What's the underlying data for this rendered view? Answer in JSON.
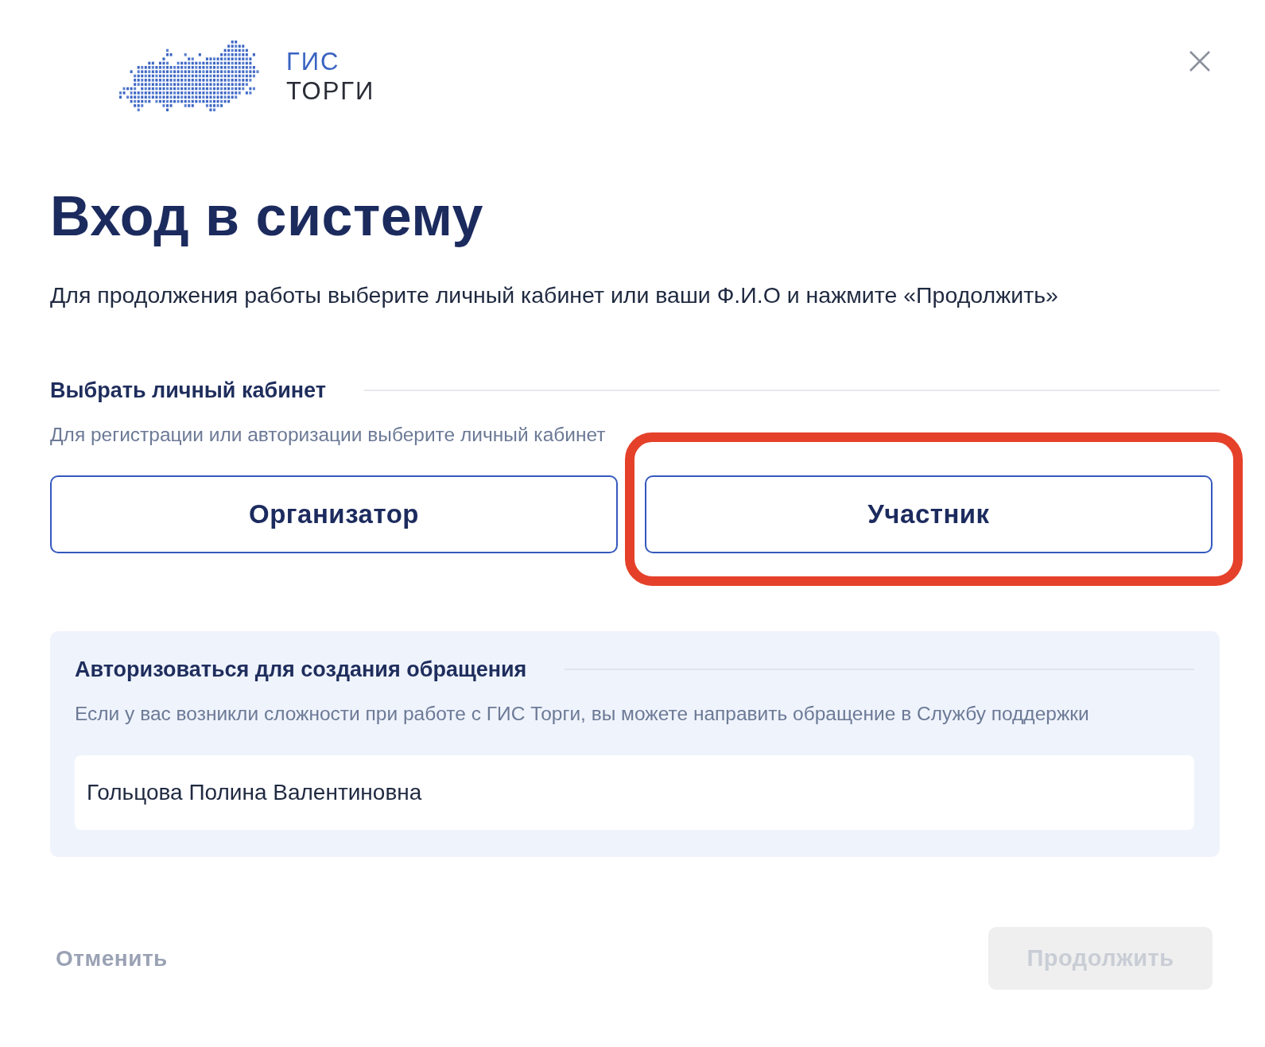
{
  "logo": {
    "line_1": "ГИС",
    "line_2": "ТОРГИ"
  },
  "title": "Вход в систему",
  "subtitle": "Для продолжения работы выберите личный кабинет или ваши Ф.И.О и нажмите «Продолжить»",
  "cabinet_section": {
    "heading": "Выбрать личный кабинет",
    "hint": "Для регистрации или авторизации выберите личный кабинет",
    "options": [
      {
        "label": "Организатор",
        "highlighted": false
      },
      {
        "label": "Участник",
        "highlighted": true
      }
    ]
  },
  "support_section": {
    "heading": "Авторизоваться для создания обращения",
    "hint": "Если у вас возникли сложности при работе с ГИС Торги, вы можете направить обращение в Службу поддержки",
    "name_field": {
      "value": "Гольцова Полина Валентиновна"
    }
  },
  "actions": {
    "cancel": {
      "label": "Отменить"
    },
    "continue": {
      "label": "Продолжить",
      "disabled": true
    }
  }
}
